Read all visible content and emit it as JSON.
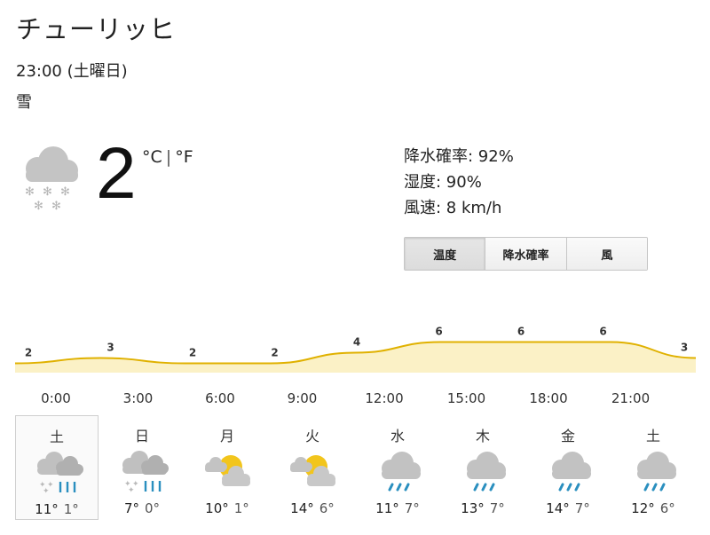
{
  "location": "チューリッヒ",
  "datetime": "23:00 (土曜日)",
  "condition": "雪",
  "current": {
    "temp": "2",
    "unit_c": "°C",
    "unit_sep": "|",
    "unit_f": "°F",
    "icon": "snow-cloud-icon"
  },
  "details": {
    "precip": "降水確率: 92%",
    "humidity": "湿度: 90%",
    "wind": "風速: 8 km/h"
  },
  "tabs": [
    "温度",
    "降水確率",
    "風"
  ],
  "active_tab": "温度",
  "chart_data": {
    "type": "area",
    "x": [
      "0:00",
      "3:00",
      "6:00",
      "9:00",
      "12:00",
      "15:00",
      "18:00",
      "21:00",
      "0:00"
    ],
    "values": [
      2,
      3,
      2,
      2,
      4,
      6,
      6,
      6,
      3
    ],
    "point_labels": [
      "2",
      "3",
      "2",
      "2",
      "4",
      "6",
      "6",
      "6",
      "3"
    ],
    "color": "#e0b100",
    "fill": "#fbf1c6"
  },
  "hours": [
    "0:00",
    "3:00",
    "6:00",
    "9:00",
    "12:00",
    "15:00",
    "18:00",
    "21:00"
  ],
  "days": [
    {
      "name": "土",
      "icon": "snow-rain-icon",
      "hi": "11°",
      "lo": "1°"
    },
    {
      "name": "日",
      "icon": "snow-rain-icon",
      "hi": "7°",
      "lo": "0°"
    },
    {
      "name": "月",
      "icon": "partly-cloudy-icon",
      "hi": "10°",
      "lo": "1°"
    },
    {
      "name": "火",
      "icon": "partly-cloudy-icon",
      "hi": "14°",
      "lo": "6°"
    },
    {
      "name": "水",
      "icon": "rain-icon",
      "hi": "11°",
      "lo": "7°"
    },
    {
      "name": "木",
      "icon": "rain-icon",
      "hi": "13°",
      "lo": "7°"
    },
    {
      "name": "金",
      "icon": "rain-icon",
      "hi": "14°",
      "lo": "7°"
    },
    {
      "name": "土",
      "icon": "rain-icon",
      "hi": "12°",
      "lo": "6°"
    }
  ]
}
